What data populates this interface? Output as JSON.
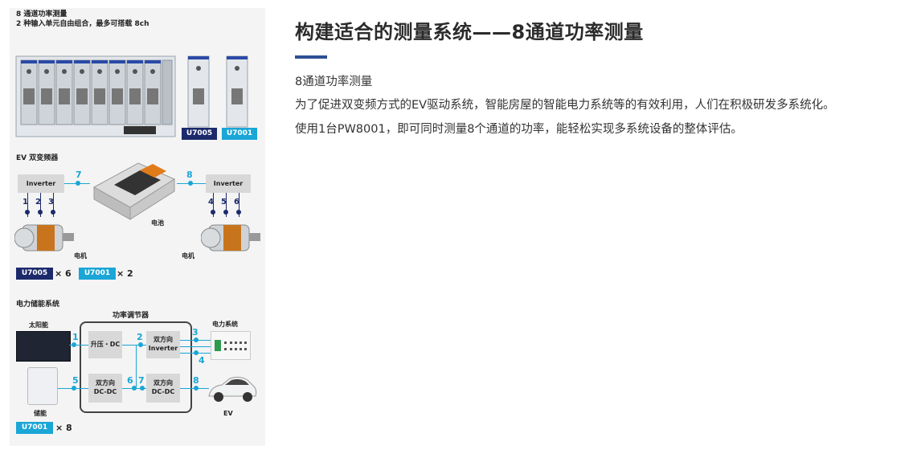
{
  "figure": {
    "heading_line1": "8 通道功率测量",
    "heading_line2": "2 种输入单元自由组合，最多可搭载 8ch",
    "unit_badges": {
      "u7005": "U7005",
      "u7001": "U7001"
    },
    "ev_section": {
      "label": "EV 双变频器",
      "inverter_left": "Inverter",
      "inverter_right": "Inverter",
      "battery_label": "电池",
      "motor_label": "电机",
      "channels_left": [
        "1",
        "2",
        "3"
      ],
      "channels_right": [
        "4",
        "5",
        "6"
      ],
      "channel_7": "7",
      "channel_8": "8",
      "badge_u7005": "U7005",
      "qty_u7005": "× 6",
      "badge_u7001": "U7001",
      "qty_u7001": "× 2"
    },
    "storage_section": {
      "label": "电力储能系统",
      "conditioner_label": "功率调节器",
      "solar_label": "太阳能",
      "storage_label": "储能",
      "grid_label": "电力系统",
      "ev_label": "EV",
      "box_boost": "升压・DC",
      "box_bi_inverter_1": "双方向",
      "box_bi_inverter_2": "Inverter",
      "box_dcdc_left_1": "双方向",
      "box_dcdc_left_2": "DC-DC",
      "box_dcdc_right_1": "双方向",
      "box_dcdc_right_2": "DC-DC",
      "channels": [
        "1",
        "2",
        "3",
        "4",
        "5",
        "6",
        "7",
        "8"
      ],
      "badge_u7001": "U7001",
      "qty_u7001": "× 8"
    }
  },
  "article": {
    "title": "构建适合的测量系统——8通道功率测量",
    "accent_color": "#2c4f95",
    "line1": "8通道功率测量",
    "line2": "为了促进双变频方式的EV驱动系统，智能房屋的智能电力系统等的有效利用，人们在积极研发多系统化。",
    "line3": "使用1台PW8001，即可同时测量8个通道的功率，能轻松实现多系统设备的整体评估。"
  },
  "colors": {
    "badge_dark": "#1c2a6b",
    "badge_cyan": "#1aa6d6"
  }
}
